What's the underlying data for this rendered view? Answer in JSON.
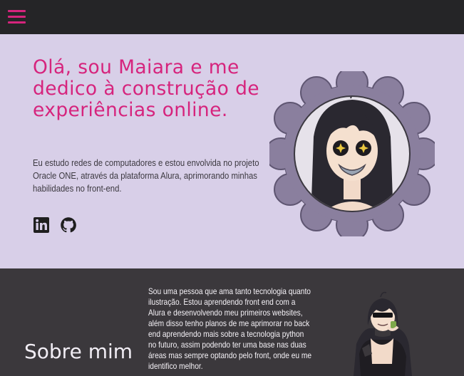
{
  "nav": {
    "menu_icon": "hamburger-menu-icon"
  },
  "hero": {
    "title": "Olá, sou Maiara e me dedico à construção de experiências online.",
    "description": "Eu estudo redes de computadores e estou envolvida no projeto Oracle ONE, através da plataforma Alura, aprimorando minhas habilidades no front-end.",
    "social": [
      "linkedin-icon",
      "github-icon"
    ]
  },
  "about": {
    "title": "Sobre mim",
    "text": "Sou uma pessoa que ama tanto tecnologia quanto ilustração. Estou aprendendo front end com a Alura e desenvolvendo meu primeiros websites, além disso tenho planos de me aprimorar no back end aprendendo mais sobre a tecnologia python no futuro, assim podendo ter uma base nas duas áreas mas sempre optando pelo front, onde eu me identifico melhor."
  },
  "colors": {
    "accent": "#d6247d",
    "hero_bg": "#d8cfe8",
    "topbar_bg": "#252527",
    "about_bg": "#3b383c"
  }
}
